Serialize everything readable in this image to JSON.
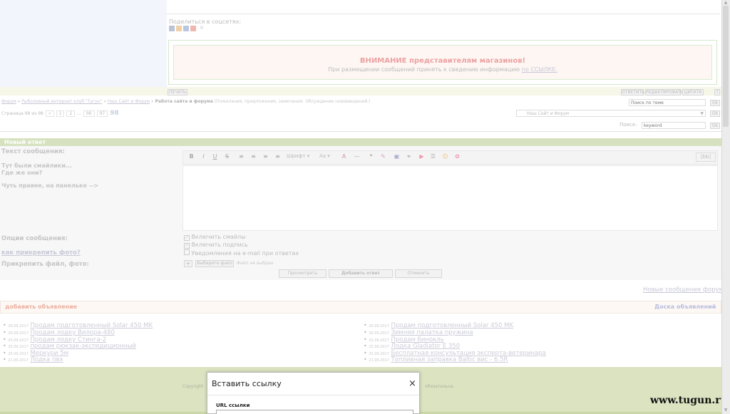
{
  "share": {
    "label": "Поделиться в соцсетях:",
    "count": "0"
  },
  "notice": {
    "title": "ВНИМАНИЕ представителям магазинов!",
    "text": "При размещении сообщений принять к сведению информацию",
    "link": "по ССЫЛКЕ."
  },
  "toolbar_top": {
    "print": "ПЕЧАТЬ",
    "reply": "ОТВЕТИТЬ",
    "edit": "РЕДАКТИРОВАТЬ",
    "quote": "ЦИТАТА",
    "num": "7"
  },
  "breadcrumb": {
    "forum": "Форум",
    "club": "Рыболовный интернет клуб \"Тугун\"",
    "site": "Наш Сайт и Форум",
    "current": "Работа сайта и форума",
    "desc": "(Пожелания, предложения, замечания. Обсуждение нововведений.)"
  },
  "topic_search": {
    "placeholder": "Поиск по теме",
    "ok": "Ok"
  },
  "pagination": {
    "label": "Страница 98 из 98",
    "prev": "«",
    "pages": [
      "1",
      "2",
      "...",
      "96",
      "97"
    ],
    "current": "98"
  },
  "jump": {
    "value": "Наш Сайт и Форум",
    "ok": "Ok"
  },
  "search": {
    "label": "Поиск:",
    "placeholder": "keyword",
    "ok": "Ok"
  },
  "reply_form": {
    "header": "Новый ответ",
    "message_label": "Текст сообщения:",
    "smileys_hint": "Тут были смайлики... Где же они?",
    "panel_hint": "Чуть правее, на панельке -->",
    "font_label": "Шрифт",
    "size_label": "Aa",
    "bb_label": "[bb]",
    "options_label": "Опции сообщения:",
    "photo_help": "как прикрепить фото?",
    "opt1": "Включить смайлы",
    "opt2": "Включить подпись",
    "opt3": "Уведомления на e-mail при ответах",
    "attach_label": "Прикрепить файл, фото:",
    "plus": "+",
    "choose": "Выберите файл",
    "no_file": "Файл не выбран",
    "preview": "Просмотреть",
    "submit": "Добавить ответ",
    "cancel": "Отменить"
  },
  "new_posts": "Новые сообщения форума",
  "ads": {
    "add": "добавить объявление",
    "board": "Доска объявлений",
    "left": [
      {
        "date": "26.09.2017",
        "title": "Продам подготовленный Solar 450 MK"
      },
      {
        "date": "26.09.2017",
        "title": "Продам лодку Вилора-480"
      },
      {
        "date": "25.09.2017",
        "title": "Продам лодку Стинга-2"
      },
      {
        "date": "25.09.2017",
        "title": "продам рюкзак-экспедиционный"
      },
      {
        "date": "25.09.2017",
        "title": "Меркури 5м"
      },
      {
        "date": "21.09.2017",
        "title": "Лодка пвх"
      }
    ],
    "right": [
      {
        "date": "26.09.2017",
        "title": "Продам подготовленный Solar 450 MK"
      },
      {
        "date": "26.09.2017",
        "title": "Зимняя палатка пружина"
      },
      {
        "date": "25.09.2017",
        "title": "Продам бинокль"
      },
      {
        "date": "25.09.2017",
        "title": "Лодка Gladiator E 350"
      },
      {
        "date": "25.09.2017",
        "title": "Бесплатная консультация эксперта-ветеринара"
      },
      {
        "date": "21.09.2017",
        "title": "Топливная заправка Baltic вис - 6.5R"
      }
    ]
  },
  "footer": {
    "copyright": "Copyright",
    "right_text": "обязательна"
  },
  "dialog": {
    "title": "Вставить ссылку",
    "close": "×",
    "url_label": "URL ссылки"
  },
  "watermark": "www.tugun.ru"
}
